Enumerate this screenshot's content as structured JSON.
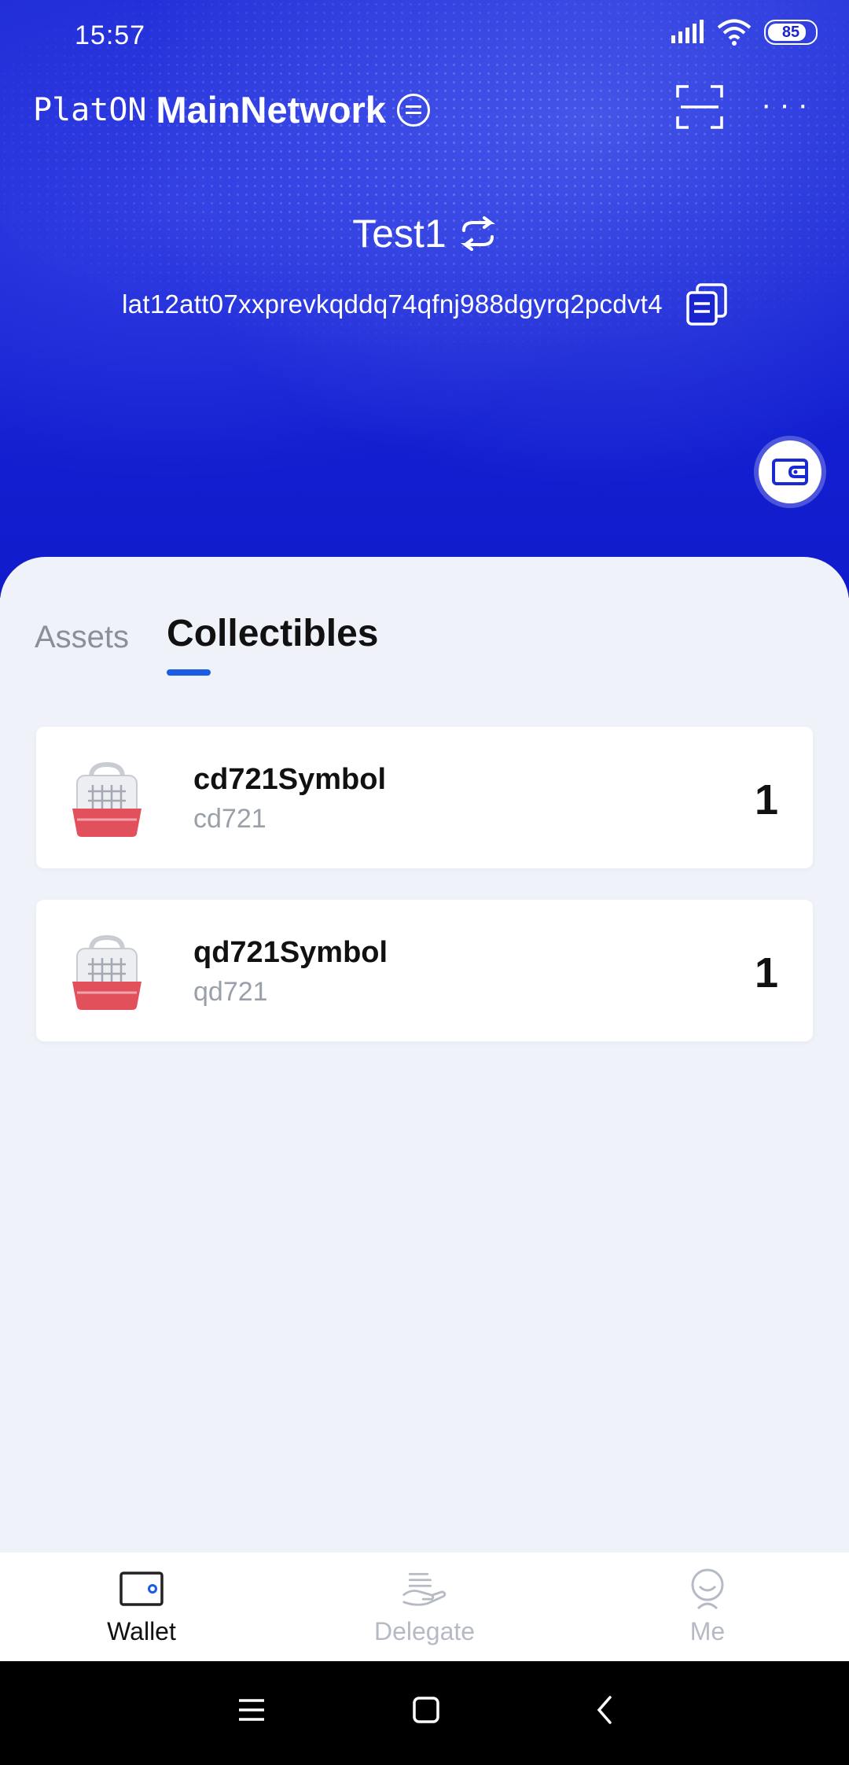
{
  "status_bar": {
    "time": "15:57",
    "battery": "85"
  },
  "header": {
    "brand": "PlatON",
    "network": "MainNetwork",
    "wallet_name": "Test1",
    "address": "lat12att07xxprevkqddq74qfnj988dgyrq2pcdvt4"
  },
  "tabs": {
    "assets": "Assets",
    "collectibles": "Collectibles",
    "active": "Collectibles"
  },
  "collectibles": [
    {
      "symbol": "cd721Symbol",
      "name": "cd721",
      "count": "1",
      "icon": "pet-carrier-icon"
    },
    {
      "symbol": "qd721Symbol",
      "name": "qd721",
      "count": "1",
      "icon": "pet-carrier-icon"
    }
  ],
  "bottom_nav": {
    "wallet": "Wallet",
    "delegate": "Delegate",
    "me": "Me",
    "active": "Wallet"
  },
  "colors": {
    "header_blue": "#1421d2",
    "accent": "#1b5ce6",
    "inactive": "#b5bac4"
  }
}
